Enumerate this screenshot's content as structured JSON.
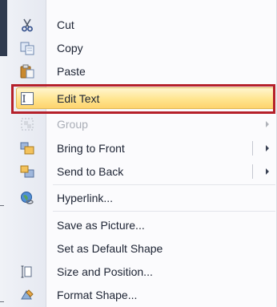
{
  "menu": {
    "items": [
      {
        "name": "cut",
        "label": "Cut",
        "icon": "scissors-icon"
      },
      {
        "name": "copy",
        "label": "Copy",
        "icon": "copy-icon"
      },
      {
        "name": "paste",
        "label": "Paste",
        "icon": "paste-icon"
      },
      {
        "name": "edit-text",
        "label": "Edit Text",
        "icon": "edit-text-icon",
        "highlighted": true
      },
      {
        "name": "group",
        "label": "Group",
        "icon": "group-icon",
        "disabled": true,
        "submenu": true
      },
      {
        "name": "bring-to-front",
        "label": "Bring to Front",
        "icon": "bring-to-front-icon",
        "submenu": true
      },
      {
        "name": "send-to-back",
        "label": "Send to Back",
        "icon": "send-to-back-icon",
        "submenu": true
      },
      {
        "name": "hyperlink",
        "label": "Hyperlink...",
        "icon": "hyperlink-globe-icon"
      },
      {
        "name": "save-as-picture",
        "label": "Save as Picture..."
      },
      {
        "name": "set-as-default-shape",
        "label": "Set as Default Shape"
      },
      {
        "name": "size-and-position",
        "label": "Size and Position...",
        "icon": "size-position-icon"
      },
      {
        "name": "format-shape",
        "label": "Format Shape...",
        "icon": "format-shape-icon"
      }
    ]
  },
  "colors": {
    "highlight": "#ffe58f",
    "highlight_border": "#e1b754",
    "callout_red": "#b5202a",
    "gutter": "#e9ecf3"
  }
}
